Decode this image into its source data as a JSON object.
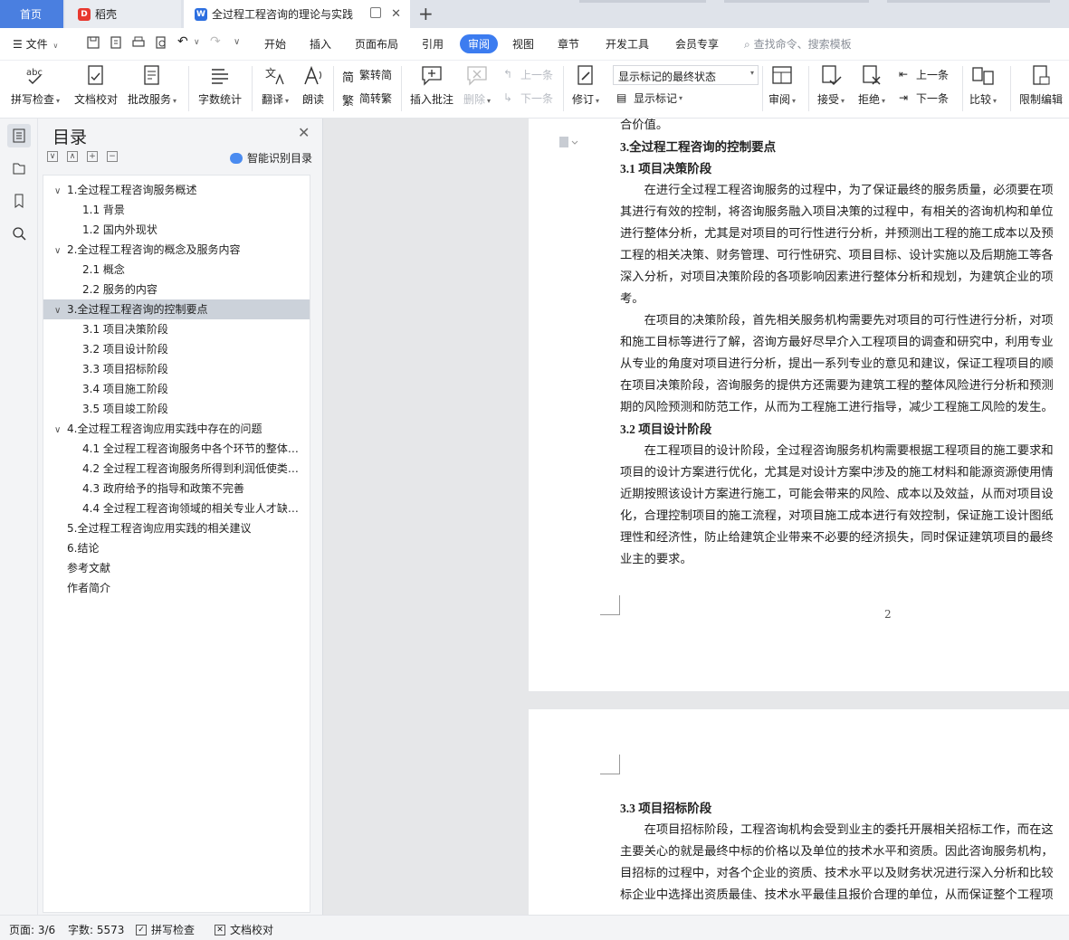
{
  "tabs": {
    "home": "首页",
    "daoke": "稻壳",
    "document": "全过程工程咨询的理论与实践"
  },
  "menu": {
    "file": "文件",
    "items": [
      "开始",
      "插入",
      "页面布局",
      "引用",
      "审阅",
      "视图",
      "章节",
      "开发工具",
      "会员专享"
    ],
    "active": "审阅",
    "search_placeholder": "查找命令、搜索模板"
  },
  "ribbon": {
    "spellcheck": "拼写检查",
    "doccheck": "文档校对",
    "correction": "批改服务",
    "wordcount": "字数统计",
    "translate": "翻译",
    "read": "朗读",
    "trad_to_simp": "繁转简",
    "simp_to_trad": "简转繁",
    "insert_comment": "插入批注",
    "delete": "删除",
    "prev_comment": "上一条",
    "next_comment": "下一条",
    "track": "修订",
    "markup_select": "显示标记的最终状态",
    "show_markup": "显示标记",
    "review": "审阅",
    "accept": "接受",
    "reject": "拒绝",
    "prev_change": "上一条",
    "next_change": "下一条",
    "compare": "比较",
    "restrict": "限制编辑"
  },
  "toc": {
    "title": "目录",
    "smart": "智能识别目录",
    "items": [
      {
        "text": "1.全过程工程咨询服务概述",
        "level": 1,
        "arrow": "∨"
      },
      {
        "text": "1.1 背景",
        "level": 2
      },
      {
        "text": "1.2 国内外现状",
        "level": 2
      },
      {
        "text": "2.全过程工程咨询的概念及服务内容",
        "level": 1,
        "arrow": "∨"
      },
      {
        "text": "2.1 概念",
        "level": 2
      },
      {
        "text": "2.2 服务的内容",
        "level": 2
      },
      {
        "text": "3.全过程工程咨询的控制要点",
        "level": 1,
        "arrow": "∨",
        "selected": true
      },
      {
        "text": "3.1 项目决策阶段",
        "level": 2
      },
      {
        "text": "3.2 项目设计阶段",
        "level": 2
      },
      {
        "text": "3.3 项目招标阶段",
        "level": 2
      },
      {
        "text": "3.4 项目施工阶段",
        "level": 2
      },
      {
        "text": "3.5 项目竣工阶段",
        "level": 2
      },
      {
        "text": "4.全过程工程咨询应用实践中存在的问题",
        "level": 1,
        "arrow": "∨"
      },
      {
        "text": "4.1 全过程工程咨询服务中各个环节的整体…",
        "level": 2
      },
      {
        "text": "4.2 全过程工程咨询服务所得到利润低使类…",
        "level": 2
      },
      {
        "text": "4.3 政府给予的指导和政策不完善",
        "level": 2
      },
      {
        "text": "4.4 全过程工程咨询领域的相关专业人才缺…",
        "level": 2
      },
      {
        "text": "5.全过程工程咨询应用实践的相关建议",
        "level": 1
      },
      {
        "text": "6.结论",
        "level": 1
      },
      {
        "text": "参考文献",
        "level": 1
      },
      {
        "text": "作者简介",
        "level": 1
      }
    ]
  },
  "doc": {
    "page1_lines": [
      {
        "text": "合价值。",
        "type": "p"
      },
      {
        "text": "3.全过程工程咨询的控制要点",
        "type": "h"
      },
      {
        "text": "3.1 项目决策阶段",
        "type": "h"
      },
      {
        "text": "　　在进行全过程工程咨询服务的过程中，为了保证最终的服务质量，必须要在项",
        "type": "p"
      },
      {
        "text": "其进行有效的控制，将咨询服务融入项目决策的过程中，有相关的咨询机构和单位",
        "type": "p"
      },
      {
        "text": "进行整体分析，尤其是对项目的可行性进行分析，并预测出工程的施工成本以及预",
        "type": "p"
      },
      {
        "text": "工程的相关决策、财务管理、可行性研究、项目目标、设计实施以及后期施工等各",
        "type": "p"
      },
      {
        "text": "深入分析，对项目决策阶段的各项影响因素进行整体分析和规划，为建筑企业的项",
        "type": "p"
      },
      {
        "text": "考。",
        "type": "p"
      },
      {
        "text": "　　在项目的决策阶段，首先相关服务机构需要先对项目的可行性进行分析，对项",
        "type": "p"
      },
      {
        "text": "和施工目标等进行了解，咨询方最好尽早介入工程项目的调查和研究中，利用专业",
        "type": "p"
      },
      {
        "text": "从专业的角度对项目进行分析，提出一系列专业的意见和建议，保证工程项目的顺",
        "type": "p"
      },
      {
        "text": "在项目决策阶段，咨询服务的提供方还需要为建筑工程的整体风险进行分析和预测",
        "type": "p"
      },
      {
        "text": "期的风险预测和防范工作，从而为工程施工进行指导，减少工程施工风险的发生。",
        "type": "p"
      },
      {
        "text": "3.2 项目设计阶段",
        "type": "h"
      },
      {
        "text": "　　在工程项目的设计阶段，全过程咨询服务机构需要根据工程项目的施工要求和",
        "type": "p"
      },
      {
        "text": "项目的设计方案进行优化，尤其是对设计方案中涉及的施工材料和能源资源使用情",
        "type": "p"
      },
      {
        "text": "近期按照该设计方案进行施工，可能会带来的风险、成本以及效益，从而对项目设",
        "type": "p"
      },
      {
        "text": "化，合理控制项目的施工流程，对项目施工成本进行有效控制，保证施工设计图纸",
        "type": "p"
      },
      {
        "text": "理性和经济性，防止给建筑企业带来不必要的经济损失，同时保证建筑项目的最终",
        "type": "p"
      },
      {
        "text": "业主的要求。",
        "type": "p"
      }
    ],
    "page_number": "2",
    "page2_lines": [
      {
        "text": "3.3 项目招标阶段",
        "type": "h"
      },
      {
        "text": "　　在项目招标阶段，工程咨询机构会受到业主的委托开展相关招标工作，而在这",
        "type": "p"
      },
      {
        "text": "主要关心的就是最终中标的价格以及单位的技术水平和资质。因此咨询服务机构，",
        "type": "p"
      },
      {
        "text": "目招标的过程中，对各个企业的资质、技术水平以及财务状况进行深入分析和比较",
        "type": "p"
      },
      {
        "text": "标企业中选择出资质最佳、技术水平最佳且报价合理的单位，从而保证整个工程项",
        "type": "p"
      }
    ]
  },
  "status": {
    "page": "页面: 3/6",
    "words": "字数: 5573",
    "spell": "拼写检查",
    "doccheck": "文档校对"
  }
}
